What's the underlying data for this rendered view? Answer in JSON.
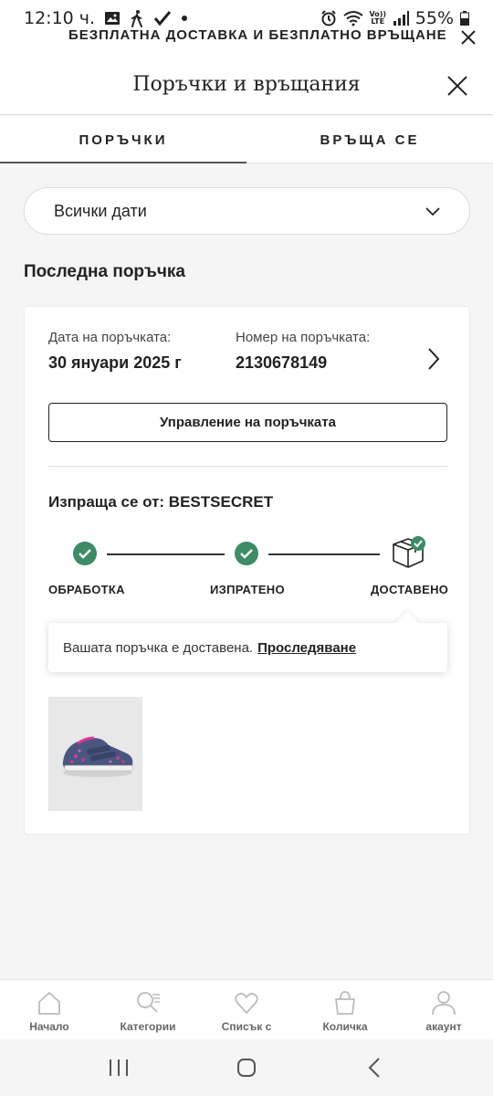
{
  "status_bar": {
    "time": "12:10 ч.",
    "battery": "55%",
    "lte_label": "Vo)) LTE"
  },
  "promo": {
    "text": "БЕЗПЛАТНА ДОСТАВКА И БЕЗПЛАТНО ВРЪЩАНЕ"
  },
  "header": {
    "title": "Поръчки и връщания"
  },
  "tabs": [
    {
      "label": "ПОРЪЧКИ",
      "active": true
    },
    {
      "label": "ВРЪЩА СЕ",
      "active": false
    }
  ],
  "date_filter": {
    "selected": "Всички дати"
  },
  "section_title": "Последна поръчка",
  "order": {
    "date_label": "Дата на поръчката:",
    "date_value": "30 януари 2025 г",
    "number_label": "Номер на поръчката:",
    "number_value": "2130678149",
    "manage_button": "Управление на поръчката",
    "shipper": "Изпраща се от: BESTSECRET",
    "steps": [
      {
        "label": "ОБРАБОТКА",
        "done": true
      },
      {
        "label": "ИЗПРАТЕНО",
        "done": true
      },
      {
        "label": "ДОСТАВЕНО",
        "done": true
      }
    ],
    "status_message": "Вашата поръчка е доставена.",
    "track_link": "Проследяване"
  },
  "bottom_nav": [
    {
      "label": "Начало",
      "icon": "home-icon"
    },
    {
      "label": "Категории",
      "icon": "search-list-icon"
    },
    {
      "label": "Списък с",
      "icon": "heart-icon"
    },
    {
      "label": "Количка",
      "icon": "bag-icon"
    },
    {
      "label": "акаунт",
      "icon": "user-icon"
    }
  ],
  "colors": {
    "accent_green": "#3d8b67",
    "background": "#f5f5f5",
    "text": "#222222"
  }
}
